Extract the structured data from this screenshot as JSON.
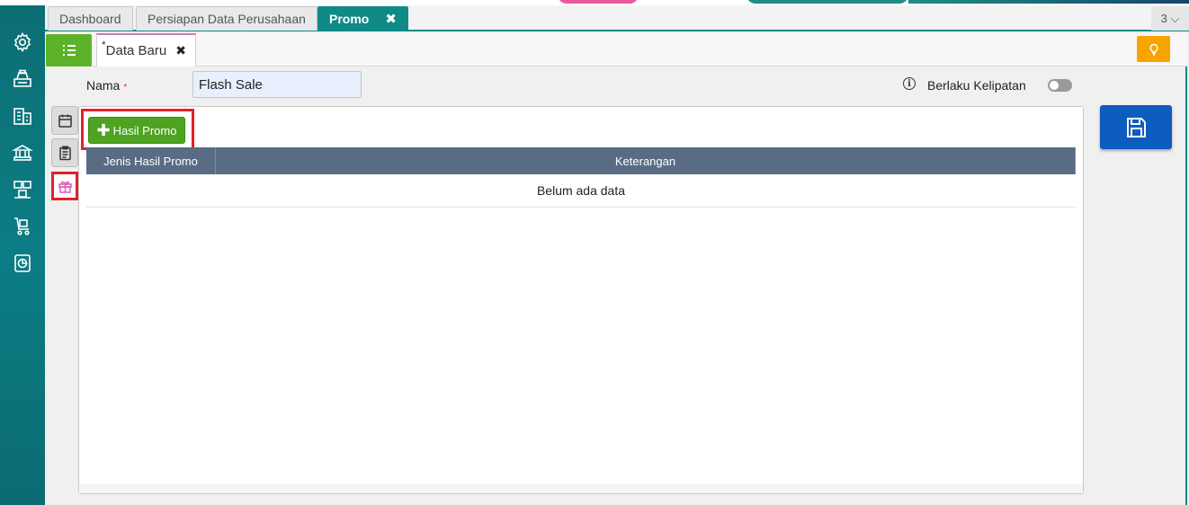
{
  "tabs": [
    {
      "label": "Dashboard",
      "active": false
    },
    {
      "label": "Persiapan Data Perusahaan",
      "active": false
    },
    {
      "label": "Promo",
      "active": true,
      "close": "✖"
    }
  ],
  "tab_counter": "3 ⌵",
  "subtab": {
    "asterisk": "*",
    "label": "Data Baru",
    "close": "✖"
  },
  "form": {
    "nama_label": "Nama",
    "required_mark": "*",
    "nama_value": "Flash Sale",
    "info_glyph": "i",
    "kelipatan_label": "Berlaku Kelipatan",
    "kelipatan_on": false
  },
  "panel": {
    "add_button_label": "Hasil Promo",
    "add_button_plus": "✚",
    "columns": [
      "Jenis Hasil Promo",
      "Keterangan"
    ],
    "empty_text": "Belum ada data"
  },
  "colors": {
    "sidebar": "#0d6e74",
    "accent_teal": "#0f8a86",
    "green": "#5cb329",
    "save_blue": "#0d5cbf",
    "bulb_orange": "#f7a400",
    "table_header": "#5a6c84",
    "highlight_red": "#e0232b"
  },
  "icons": {
    "sidebar": [
      "gear-icon",
      "cashier-icon",
      "building-icon",
      "bank-icon",
      "warehouse-icon",
      "cart-icon",
      "report-icon"
    ],
    "side_tabs": [
      "calendar-icon",
      "clipboard-icon",
      "gift-icon"
    ]
  }
}
